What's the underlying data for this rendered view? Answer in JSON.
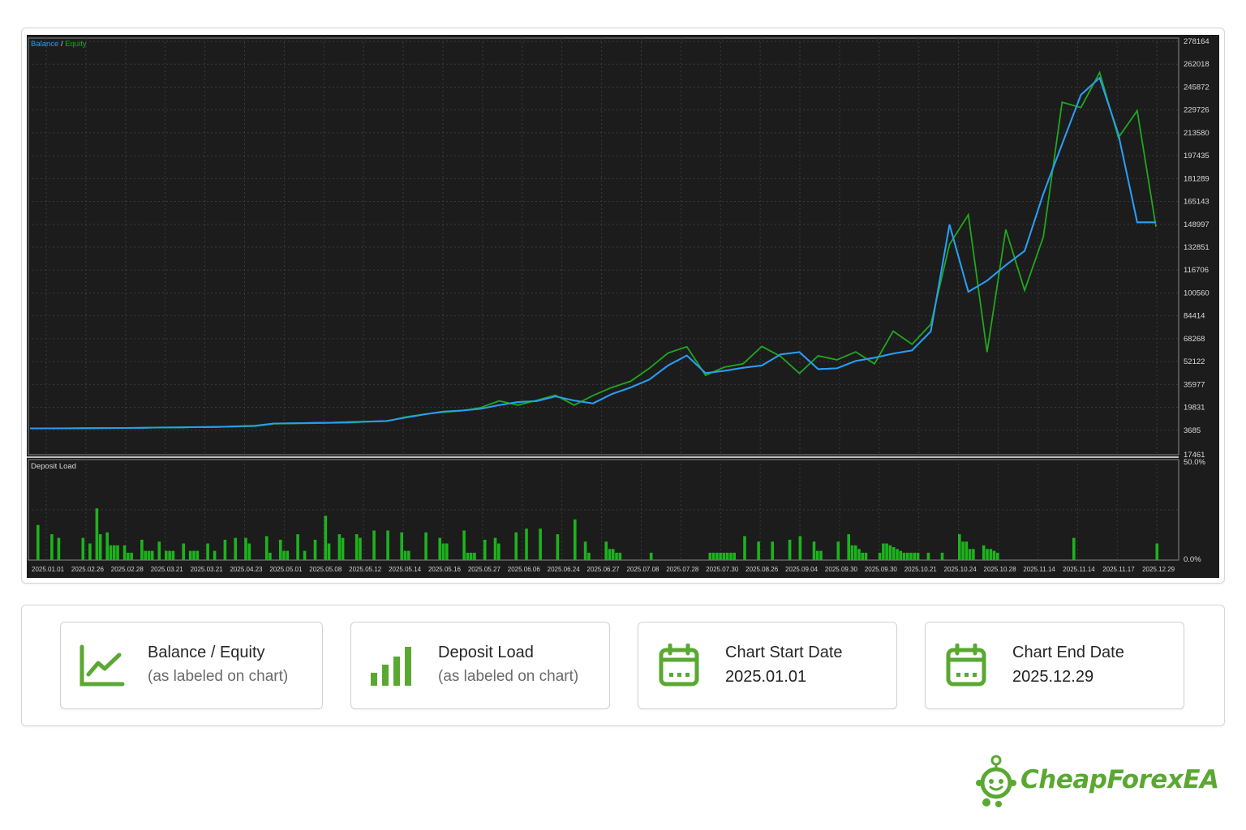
{
  "chart_data": {
    "type": "line",
    "upper": {
      "legend": [
        {
          "name": "Balance",
          "color": "#2a9df4"
        },
        {
          "name": "Equity",
          "color": "#1fa81f"
        }
      ],
      "legend_separator": " / ",
      "y_ticks": [
        278164,
        262018,
        245872,
        229726,
        213580,
        197435,
        181289,
        165143,
        148997,
        132851,
        116706,
        100560,
        84414,
        68268,
        52122,
        35977,
        19831,
        3685,
        17461
      ],
      "ylim": [
        3685,
        278164
      ],
      "series": [
        {
          "name": "Balance",
          "color": "#2a9df4",
          "values": [
            5000,
            5000,
            5050,
            5100,
            5200,
            5300,
            5400,
            5600,
            5700,
            5900,
            6000,
            6400,
            6800,
            8400,
            8600,
            8800,
            9000,
            9400,
            9800,
            10200,
            12600,
            14800,
            16800,
            17600,
            18800,
            21400,
            23600,
            24200,
            27600,
            24600,
            22600,
            29200,
            33800,
            39400,
            49400,
            56400,
            44000,
            45600,
            47800,
            49400,
            57200,
            58800,
            46800,
            47400,
            52600,
            54800,
            57800,
            60000,
            73400,
            148800,
            101400,
            109200,
            120200,
            130200,
            170600,
            205600,
            240400,
            252400,
            212600,
            150400,
            150400
          ],
          "color_hex": "#2a9df4"
        },
        {
          "name": "Equity",
          "color": "#1fa81f",
          "values": [
            5000,
            5000,
            5050,
            5150,
            5200,
            5300,
            5350,
            5600,
            5650,
            5900,
            6000,
            6200,
            6600,
            8200,
            8400,
            8600,
            8800,
            9000,
            9600,
            10000,
            13000,
            15000,
            16400,
            17400,
            19600,
            24400,
            21400,
            24800,
            28400,
            21400,
            28200,
            33800,
            38200,
            47400,
            58200,
            62600,
            42400,
            48200,
            50600,
            62800,
            55800,
            43800,
            56200,
            53400,
            59000,
            50600,
            73600,
            64400,
            78400,
            134800,
            155800,
            58800,
            145400,
            102400,
            140200,
            235200,
            231400,
            256200,
            210200,
            229200,
            147200
          ],
          "color_hex": "#1fa81f"
        }
      ]
    },
    "lower": {
      "title": "Deposit Load",
      "y_ticks": [
        "50.0%",
        "0.0%"
      ],
      "ylim": [
        0,
        50
      ],
      "bars": [
        19,
        0,
        0,
        0,
        14,
        0,
        12,
        0,
        0,
        0,
        0,
        0,
        0,
        12,
        0,
        9,
        0,
        28,
        14,
        0,
        15,
        8,
        8,
        8,
        0,
        8,
        4,
        4,
        0,
        0,
        11,
        5,
        5,
        5,
        0,
        10,
        0,
        5,
        5,
        5,
        0,
        0,
        9,
        0,
        5,
        5,
        5,
        0,
        0,
        9,
        0,
        5,
        0,
        0,
        11,
        0,
        0,
        12,
        0,
        0,
        12,
        9,
        0,
        0,
        0,
        0,
        13,
        4,
        0,
        0,
        11,
        5,
        5,
        0,
        0,
        14,
        0,
        5,
        0,
        0,
        11,
        0,
        0,
        24,
        9,
        0,
        0,
        14,
        12,
        0,
        0,
        0,
        14,
        12,
        0,
        0,
        0,
        16,
        0,
        0,
        0,
        16,
        0,
        0,
        0,
        15,
        5,
        5,
        0,
        0,
        0,
        0,
        15,
        0,
        0,
        0,
        12,
        9,
        9,
        0,
        0,
        0,
        0,
        16,
        4,
        4,
        4,
        0,
        0,
        11,
        0,
        0,
        12,
        9,
        0,
        0,
        0,
        0,
        15,
        0,
        0,
        17,
        0,
        0,
        0,
        17,
        0,
        0,
        0,
        0,
        14,
        0,
        0,
        0,
        0,
        22,
        0,
        0,
        10,
        4,
        0,
        0,
        0,
        0,
        10,
        6,
        6,
        4,
        4,
        0,
        0,
        0,
        0,
        0,
        0,
        0,
        0,
        4,
        0,
        0,
        0,
        0,
        0,
        0,
        0,
        0,
        0,
        0,
        0,
        0,
        0,
        0,
        0,
        0,
        4,
        4,
        4,
        4,
        4,
        4,
        4,
        4,
        0,
        0,
        13,
        0,
        0,
        0,
        10,
        0,
        0,
        0,
        10,
        0,
        0,
        0,
        0,
        11,
        0,
        0,
        13,
        0,
        0,
        0,
        10,
        5,
        5,
        0,
        0,
        0,
        0,
        10,
        0,
        0,
        14,
        8,
        8,
        6,
        4,
        4,
        0,
        0,
        0,
        4,
        9,
        9,
        8,
        7,
        6,
        5,
        4,
        4,
        4,
        4,
        4,
        0,
        0,
        4,
        0,
        0,
        0,
        4,
        0,
        0,
        0,
        0,
        14,
        10,
        10,
        6,
        6,
        0,
        0,
        8,
        6,
        6,
        5,
        4,
        0,
        0,
        0,
        0,
        0,
        0,
        0,
        0,
        0,
        0,
        0,
        0,
        0,
        0,
        0,
        0,
        0,
        0,
        0,
        0,
        0,
        12,
        0,
        0,
        0,
        0,
        0,
        0,
        0,
        0,
        0,
        0,
        0,
        0,
        0,
        0,
        0,
        0,
        0,
        0,
        0,
        0,
        0,
        0,
        0,
        9,
        0
      ]
    },
    "x_ticks": [
      "2025.01.01",
      "2025.02.26",
      "2025.02.28",
      "2025.03.21",
      "2025.03.21",
      "2025.04.23",
      "2025.05.01",
      "2025.05.08",
      "2025.05.12",
      "2025.05.14",
      "2025.05.16",
      "2025.05.27",
      "2025.06.06",
      "2025.06.24",
      "2025.06.27",
      "2025.07.08",
      "2025.07.28",
      "2025.07.30",
      "2025.08.26",
      "2025.09.04",
      "2025.09.30",
      "2025.09.30",
      "2025.10.21",
      "2025.10.24",
      "2025.10.28",
      "2025.11.14",
      "2025.11.14",
      "2025.11.17",
      "2025.12.29"
    ],
    "grid": true,
    "background": "#1c1c1c",
    "deposit_color": "#1db31d"
  },
  "cards": [
    {
      "title": "Balance / Equity",
      "sub": "(as labeled on chart)",
      "icon": "line-chart-icon"
    },
    {
      "title": "Deposit Load",
      "sub": "(as labeled on chart)",
      "icon": "bar-chart-icon"
    },
    {
      "title": "Chart Start Date",
      "sub": "2025.01.01",
      "icon": "calendar-icon"
    },
    {
      "title": "Chart End Date",
      "sub": "2025.12.29",
      "icon": "calendar-icon"
    }
  ],
  "accent_color": "#5aa832",
  "logo": {
    "text": "CheapForexEA",
    "icon": "robot-mascot-icon"
  }
}
